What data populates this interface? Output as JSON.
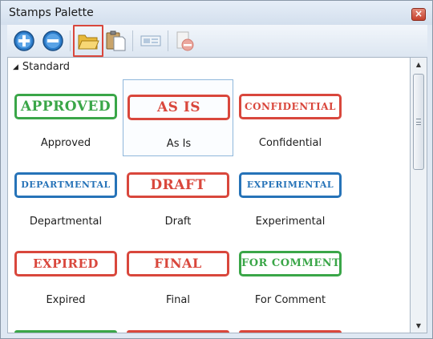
{
  "window": {
    "title": "Stamps Palette",
    "close_glyph": "×"
  },
  "toolbar": {
    "buttons": [
      {
        "name": "add-stamp-button",
        "icon": "plus-circle-icon"
      },
      {
        "name": "remove-stamp-button",
        "icon": "minus-circle-icon"
      },
      {
        "name": "open-folder-button",
        "icon": "folder-open-icon",
        "highlighted": true
      },
      {
        "name": "paste-button",
        "icon": "clipboard-icon"
      },
      {
        "name": "properties-button",
        "icon": "properties-icon",
        "disabled": true
      },
      {
        "name": "delete-button",
        "icon": "delete-icon",
        "disabled": true
      }
    ]
  },
  "group": {
    "label": "Standard",
    "expanded": true
  },
  "stamps": [
    {
      "text": "APPROVED",
      "label": "Approved",
      "color": "#3aa648",
      "selected": false
    },
    {
      "text": "AS IS",
      "label": "As Is",
      "color": "#d9473c",
      "selected": true
    },
    {
      "text": "CONFIDENTIAL",
      "label": "Confidential",
      "color": "#d9473c",
      "selected": false
    },
    {
      "text": "DEPARTMENTAL",
      "label": "Departmental",
      "color": "#2673b8",
      "selected": false
    },
    {
      "text": "DRAFT",
      "label": "Draft",
      "color": "#d9473c",
      "selected": false
    },
    {
      "text": "EXPERIMENTAL",
      "label": "Experimental",
      "color": "#2673b8",
      "selected": false
    },
    {
      "text": "EXPIRED",
      "label": "Expired",
      "color": "#d9473c",
      "selected": false
    },
    {
      "text": "FINAL",
      "label": "Final",
      "color": "#d9473c",
      "selected": false
    },
    {
      "text": "FOR COMMENT",
      "label": "For Comment",
      "color": "#3aa648",
      "selected": false
    }
  ],
  "next_row_colors": [
    "#3aa648",
    "#d9473c",
    "#d9473c"
  ],
  "colors": {
    "highlight": "#d9473c",
    "selection": "#8fb7db"
  }
}
